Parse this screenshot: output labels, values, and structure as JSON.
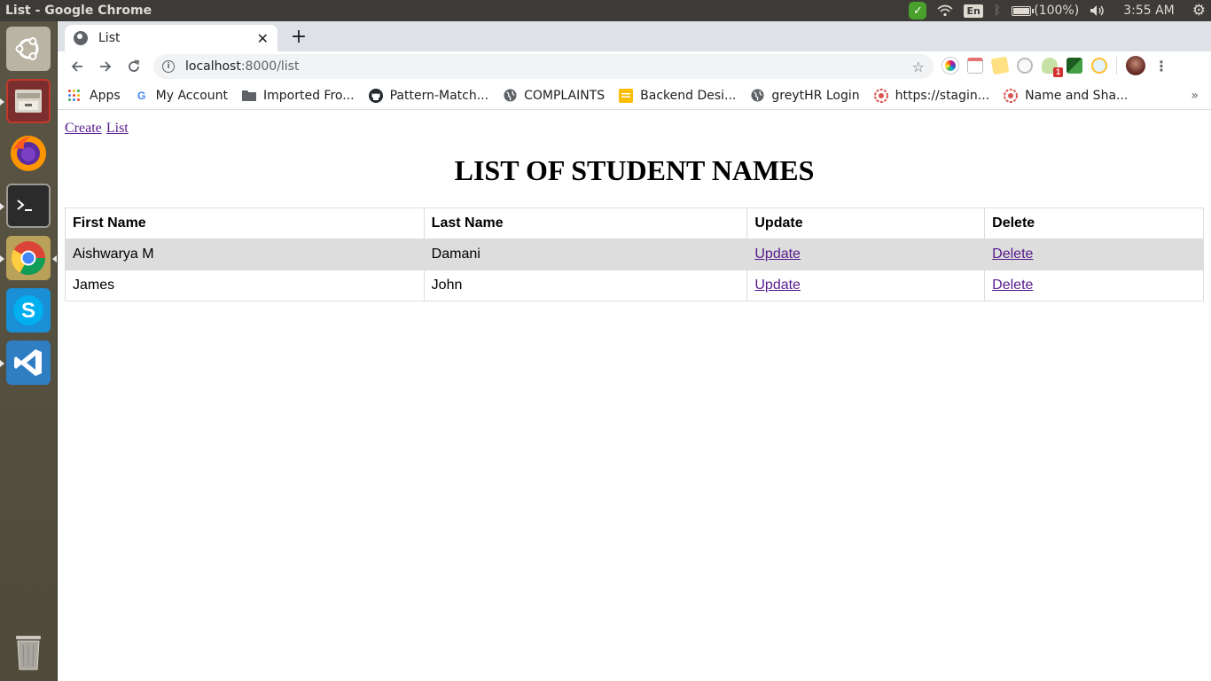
{
  "system": {
    "window_title": "List - Google Chrome",
    "language": "En",
    "battery": "(100%)",
    "clock": "3:55 AM"
  },
  "launcher": {
    "items": [
      "ubuntu-dash",
      "files",
      "firefox",
      "terminal",
      "chrome",
      "skype",
      "vscode",
      "trash"
    ]
  },
  "browser": {
    "tab_title": "List",
    "url_host": "localhost",
    "url_path": ":8000/list",
    "bookmarks": [
      {
        "label": "Apps",
        "icon": "apps-grid-icon"
      },
      {
        "label": "My Account",
        "icon": "google-icon"
      },
      {
        "label": "Imported Fro...",
        "icon": "folder-icon"
      },
      {
        "label": "Pattern-Match...",
        "icon": "github-icon"
      },
      {
        "label": "COMPLAINTS",
        "icon": "globe-icon"
      },
      {
        "label": "Backend Desi...",
        "icon": "sheets-icon"
      },
      {
        "label": "greytHR Login",
        "icon": "globe-icon"
      },
      {
        "label": "https://stagin...",
        "icon": "gear-favicon-icon"
      },
      {
        "label": "Name and Sha...",
        "icon": "gear-favicon-icon"
      }
    ],
    "extension_badge": "1"
  },
  "page": {
    "nav": {
      "create": "Create",
      "list": "List"
    },
    "title": "LIST OF STUDENT NAMES",
    "table": {
      "headers": [
        "First Name",
        "Last Name",
        "Update",
        "Delete"
      ],
      "rows": [
        {
          "first": "Aishwarya M",
          "last": "Damani",
          "update": "Update",
          "delete": "Delete"
        },
        {
          "first": "James",
          "last": "John",
          "update": "Update",
          "delete": "Delete"
        }
      ]
    }
  },
  "colors": {
    "link": "#551a8b",
    "row_shade": "#dddddd",
    "panel": "#3c3b37"
  }
}
